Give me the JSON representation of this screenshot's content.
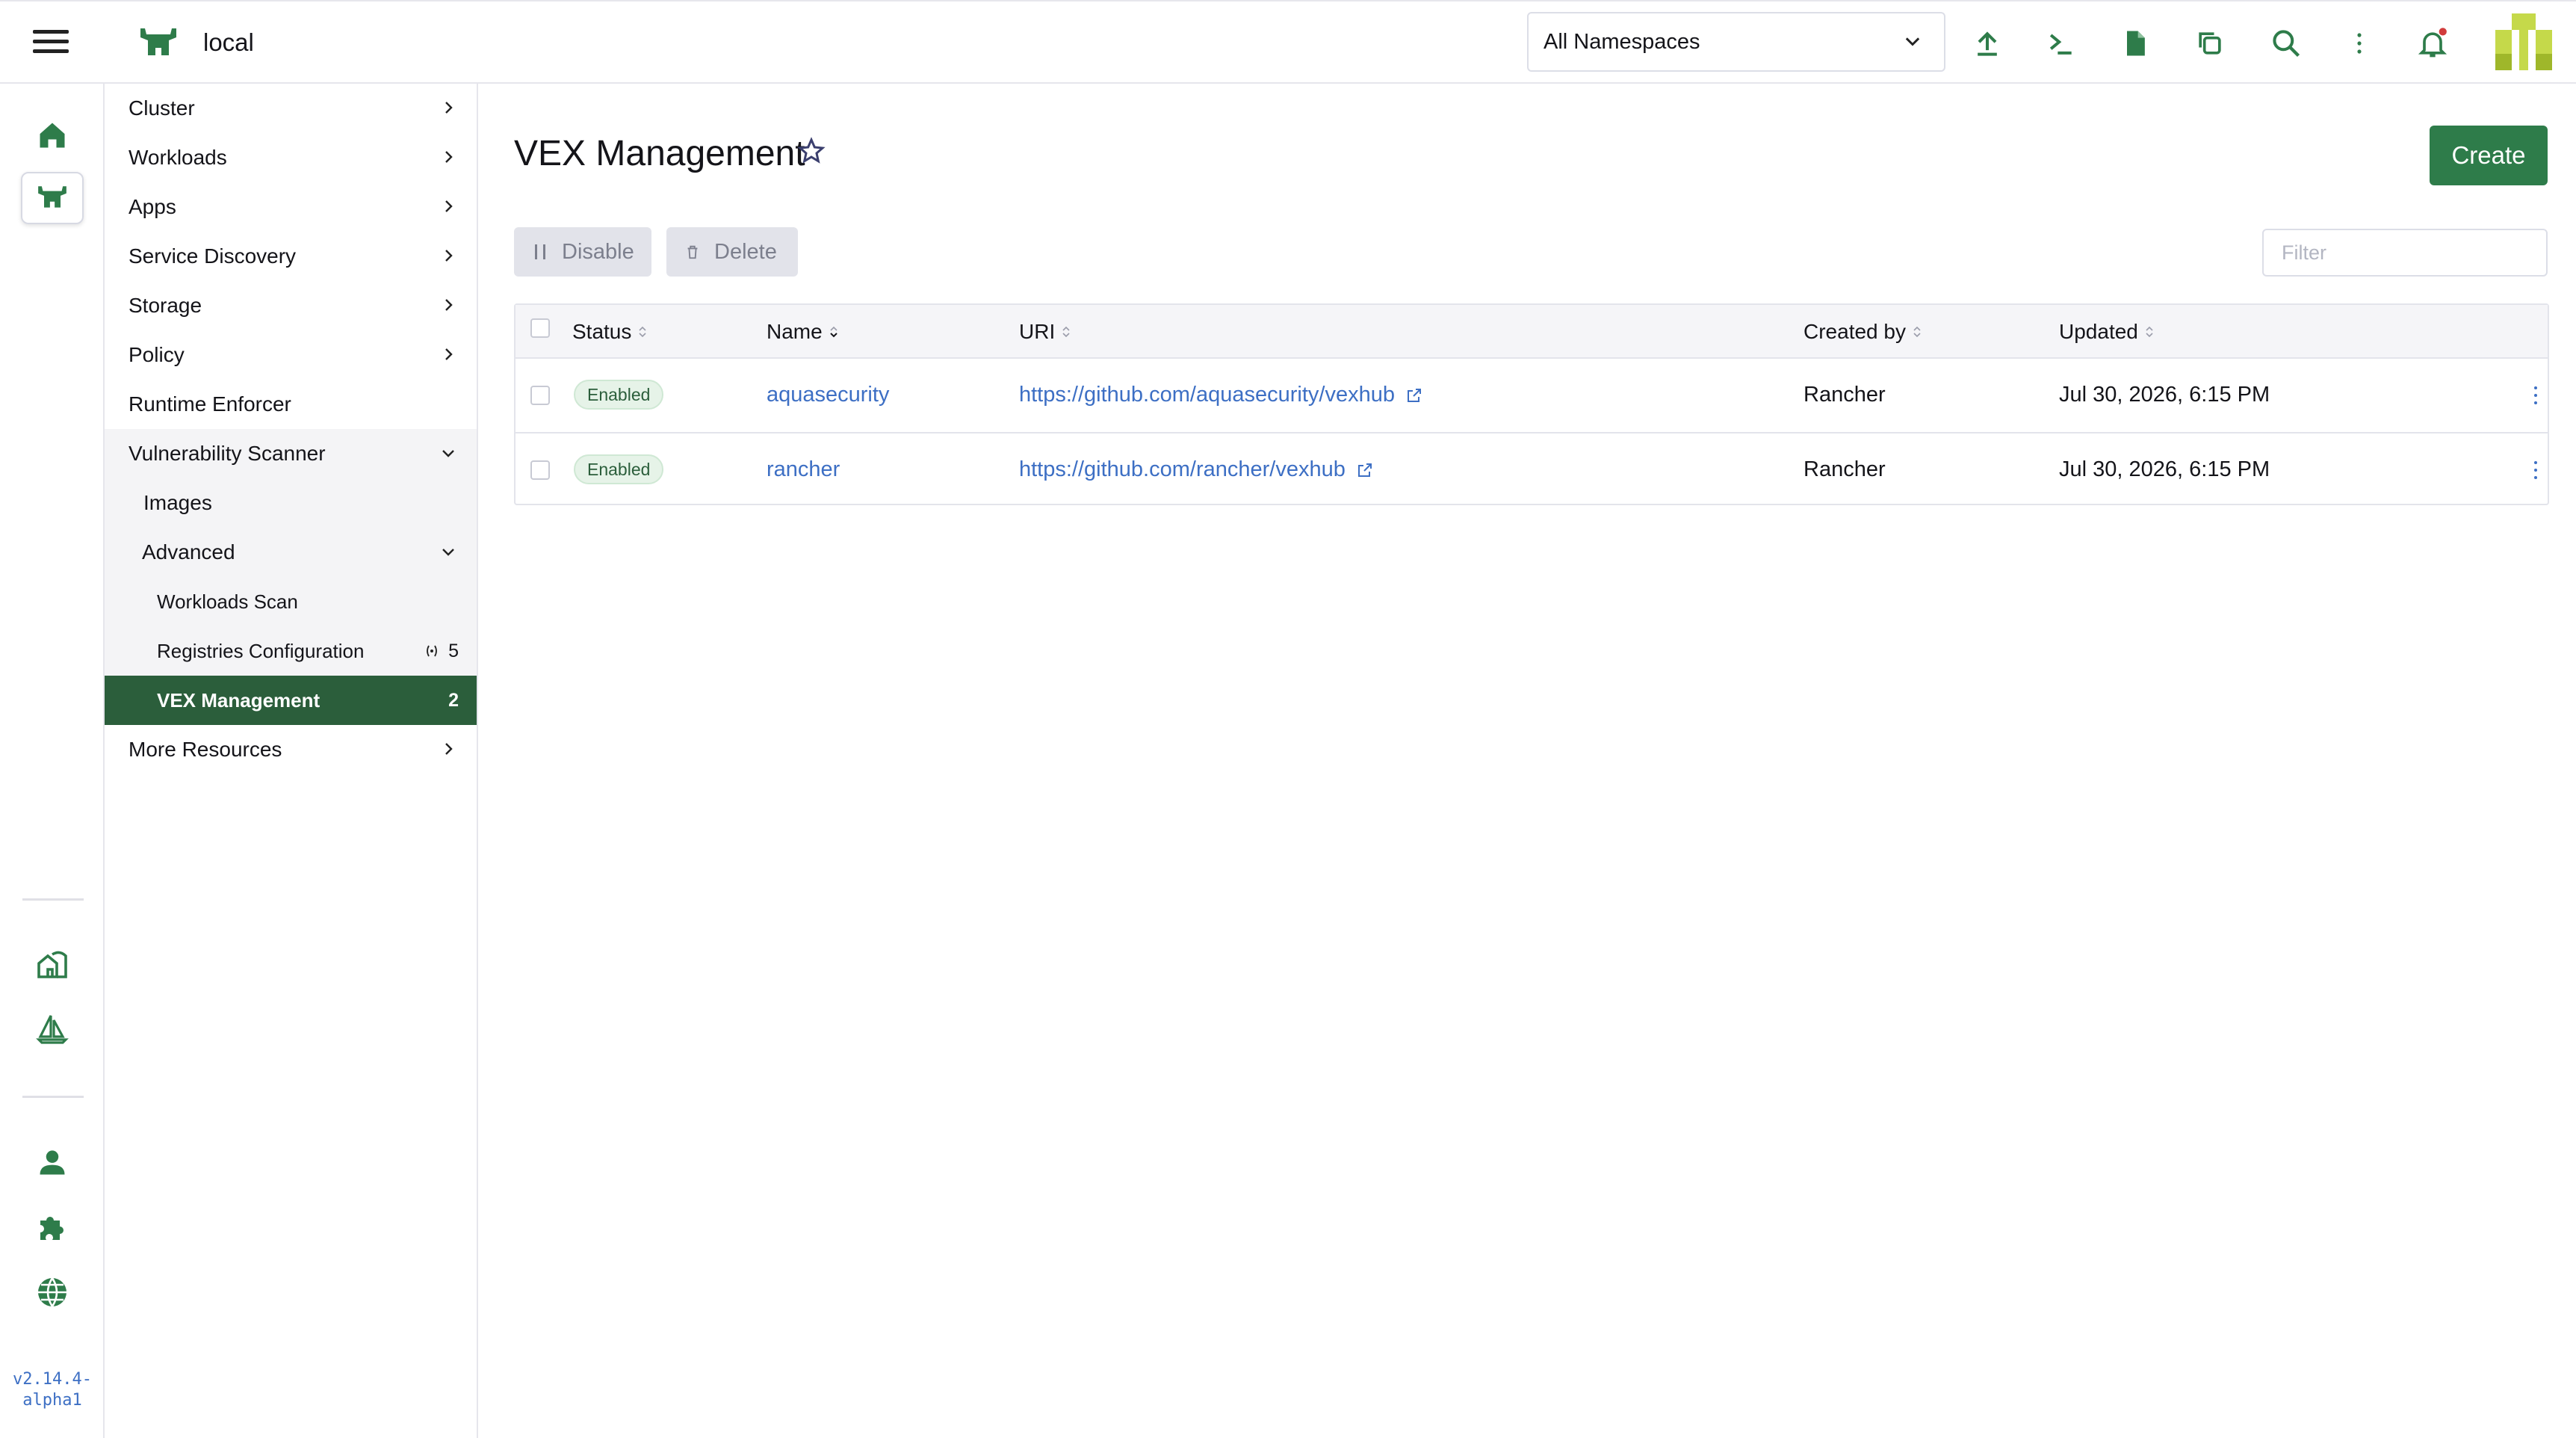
{
  "header": {
    "cluster_name": "local",
    "namespace_selector": "All Namespaces",
    "icons": [
      "import-yaml-icon",
      "kubectl-shell-icon",
      "kubeconfig-file-icon",
      "copy-kubeconfig-icon",
      "resource-search-icon",
      "more-options-icon",
      "notifications-bell-icon"
    ],
    "notification_dot_color": "#d13c3c"
  },
  "rail": {
    "items": [
      "home-icon",
      "cluster-icon",
      "fleet-icon",
      "sailboat-icon",
      "user-icon",
      "extensions-icon",
      "global-settings-icon"
    ],
    "version_line1": "v2.14.4-",
    "version_line2": "alpha1"
  },
  "sidenav": {
    "items": [
      {
        "label": "Cluster"
      },
      {
        "label": "Workloads"
      },
      {
        "label": "Apps"
      },
      {
        "label": "Service Discovery"
      },
      {
        "label": "Storage"
      },
      {
        "label": "Policy"
      },
      {
        "label": "Runtime Enforcer"
      },
      {
        "label": "Vulnerability Scanner"
      },
      {
        "label": "Images"
      },
      {
        "label": "Advanced"
      },
      {
        "label": "Workloads Scan"
      },
      {
        "label": "Registries Configuration",
        "count": "5"
      },
      {
        "label": "VEX Management",
        "count": "2"
      },
      {
        "label": "More Resources"
      }
    ]
  },
  "main": {
    "title": "VEX Management",
    "create_label": "Create",
    "disable_label": "Disable",
    "delete_label": "Delete",
    "filter_placeholder": "Filter",
    "columns": [
      "Status",
      "Name",
      "URI",
      "Created by",
      "Updated"
    ],
    "rows": [
      {
        "status": "Enabled",
        "name": "aquasecurity",
        "uri": "https://github.com/aquasecurity/vexhub",
        "created_by": "Rancher",
        "updated": "Jul 30, 2026, 6:15 PM"
      },
      {
        "status": "Enabled",
        "name": "rancher",
        "uri": "https://github.com/rancher/vexhub",
        "created_by": "Rancher",
        "updated": "Jul 30, 2026, 6:15 PM"
      }
    ]
  },
  "colors": {
    "brand_green": "#2e7c4a",
    "nav_selected": "#2b5e3b",
    "link_blue": "#3d6fc4"
  }
}
